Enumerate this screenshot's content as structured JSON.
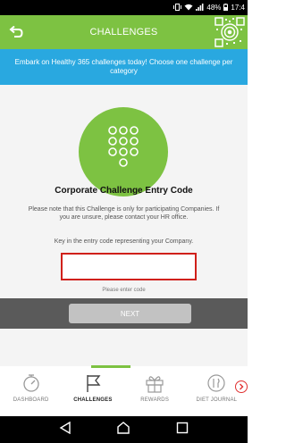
{
  "status_bar": {
    "battery": "48%",
    "time": "17:4"
  },
  "header": {
    "title": "CHALLENGES"
  },
  "banner": {
    "text": "Embark on Healthy 365 challenges today! Choose one challenge per category"
  },
  "main": {
    "title": "Corporate Challenge Entry Code",
    "note": "Please note that this Challenge is only for participating Companies. If you are unsure, please contact your HR office.",
    "instruction": "Key in the entry code representing your Company.",
    "code_input": {
      "value": "",
      "placeholder": ""
    },
    "hint": "Please enter code",
    "next_label": "NEXT"
  },
  "bottom_nav": {
    "items": [
      {
        "label": "DASHBOARD",
        "icon": "dashboard-icon"
      },
      {
        "label": "CHALLENGES",
        "icon": "flag-icon"
      },
      {
        "label": "REWARDS",
        "icon": "gift-icon"
      },
      {
        "label": "DIET JOURNAL",
        "icon": "diet-journal-icon"
      }
    ],
    "active": "CHALLENGES"
  },
  "colors": {
    "primary_green": "#7dc242",
    "banner_blue": "#29a8e0",
    "input_border_red": "#d0201a"
  }
}
